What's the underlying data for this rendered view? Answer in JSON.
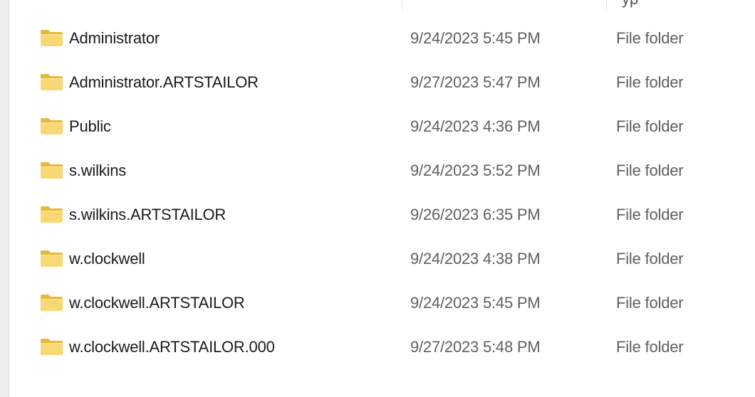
{
  "header": {
    "type_column_fragment": "yp"
  },
  "files": [
    {
      "name": "Administrator",
      "date_modified": "9/24/2023 5:45 PM",
      "type": "File folder",
      "icon": "folder-icon"
    },
    {
      "name": "Administrator.ARTSTAILOR",
      "date_modified": "9/27/2023 5:47 PM",
      "type": "File folder",
      "icon": "folder-icon"
    },
    {
      "name": "Public",
      "date_modified": "9/24/2023 4:36 PM",
      "type": "File folder",
      "icon": "folder-icon"
    },
    {
      "name": "s.wilkins",
      "date_modified": "9/24/2023 5:52 PM",
      "type": "File folder",
      "icon": "folder-icon"
    },
    {
      "name": "s.wilkins.ARTSTAILOR",
      "date_modified": "9/26/2023 6:35 PM",
      "type": "File folder",
      "icon": "folder-icon"
    },
    {
      "name": "w.clockwell",
      "date_modified": "9/24/2023 4:38 PM",
      "type": "File folder",
      "icon": "folder-icon"
    },
    {
      "name": "w.clockwell.ARTSTAILOR",
      "date_modified": "9/24/2023 5:45 PM",
      "type": "File folder",
      "icon": "folder-icon"
    },
    {
      "name": "w.clockwell.ARTSTAILOR.000",
      "date_modified": "9/27/2023 5:48 PM",
      "type": "File folder",
      "icon": "folder-icon"
    }
  ],
  "colors": {
    "folder_body": "#f8d775",
    "folder_tab": "#e9b83b",
    "name_text": "#1a1a1a",
    "secondary_text": "#5f5f5f"
  }
}
